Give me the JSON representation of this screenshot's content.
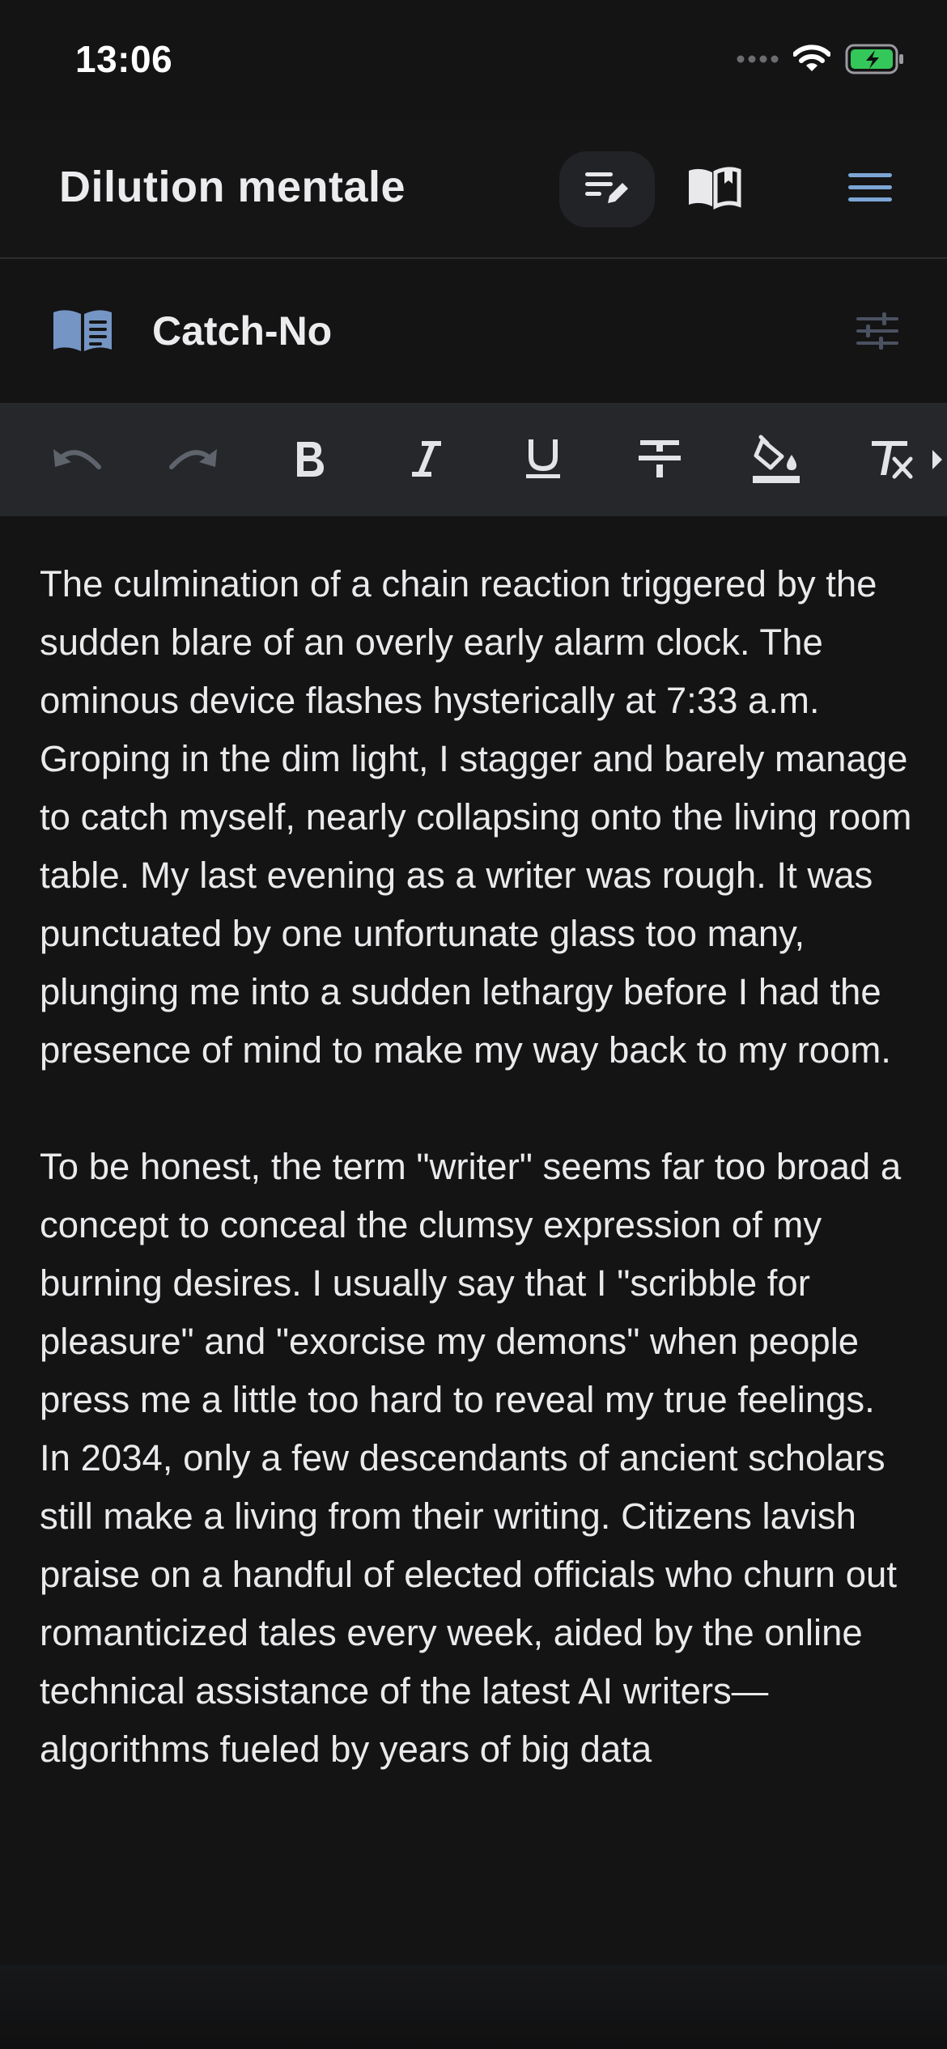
{
  "status_bar": {
    "time": "13:06",
    "icons": [
      "signal-icon",
      "wifi-icon",
      "battery-charging-icon"
    ],
    "battery_color": "#34c759"
  },
  "header": {
    "title": "Dilution mentale",
    "buttons": [
      "edit-mode-icon",
      "read-mode-icon",
      "menu-icon"
    ],
    "menu_color": "#7da6d6"
  },
  "chapter": {
    "title": "Catch-No",
    "icon": "book-icon",
    "settings_icon": "sliders-icon",
    "icon_color": "#7596c4"
  },
  "toolbar": {
    "tools": [
      "undo-icon",
      "redo-icon",
      "bold-icon",
      "italic-icon",
      "underline-icon",
      "strikethrough-icon",
      "highlight-icon",
      "clear-format-icon"
    ],
    "more": "more-arrow-icon"
  },
  "editor": {
    "paragraphs": [
      "The culmination of a chain reaction triggered by the sudden blare of an overly early alarm clock. The ominous device flashes hysterically at 7:33 a.m. Groping in the dim light, I stagger and barely manage to catch myself, nearly collapsing onto the living room table. My last evening as a writer was rough. It was punctuated by one unfortunate glass too many, plunging me into a sudden lethargy before I had the presence of mind to make my way back to my room.",
      "To be honest, the term \"writer\" seems far too broad a concept to conceal the clumsy expression of my burning desires. I usually say that I \"scribble for pleasure\" and \"exorcise my demons\" when people press me a little too hard to reveal my true feelings. In 2034, only a few descendants of ancient scholars still make a living from their writing. Citizens lavish praise on a handful of elected officials who churn out romanticized tales every week, aided by the online technical assistance of the latest AI writers—algorithms fueled by years of big data"
    ]
  }
}
